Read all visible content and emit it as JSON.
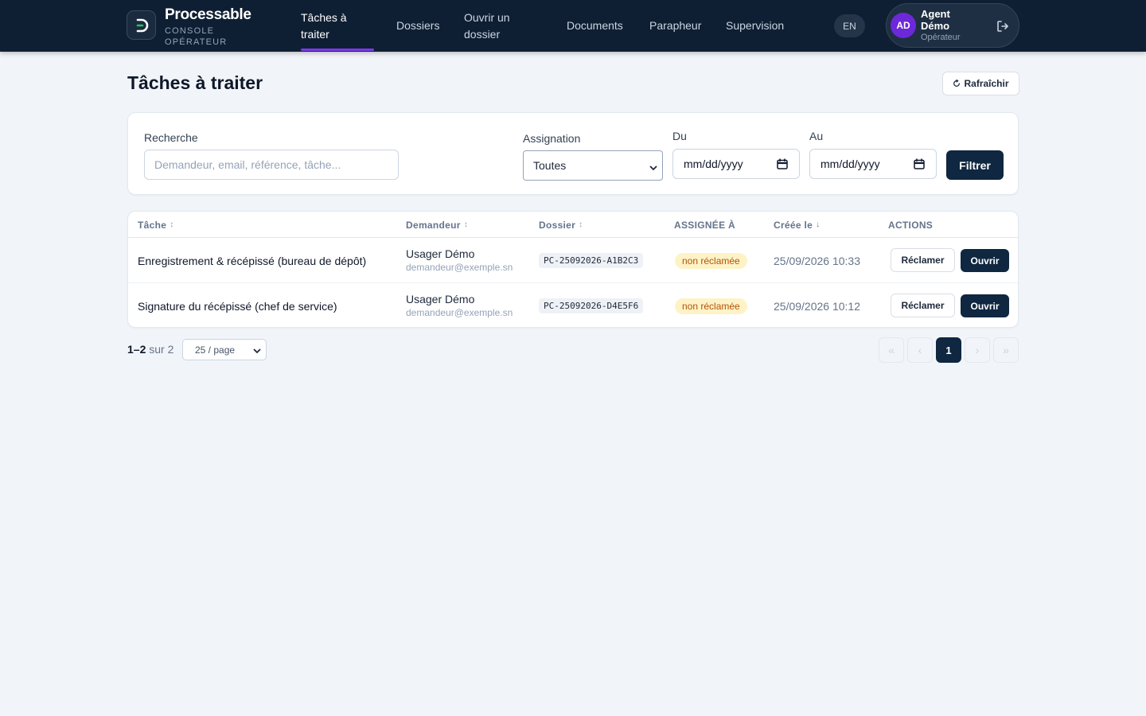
{
  "app": {
    "name": "Processable",
    "subtitle": "CONSOLE OPÉRATEUR"
  },
  "nav": {
    "items": [
      {
        "label": "Tâches à traiter",
        "active": true
      },
      {
        "label": "Dossiers"
      },
      {
        "label": "Ouvrir un dossier"
      },
      {
        "label": "Documents"
      },
      {
        "label": "Parapheur"
      },
      {
        "label": "Supervision"
      }
    ],
    "lang": "EN"
  },
  "user": {
    "initials": "AD",
    "name": "Agent Démo",
    "role": "Opérateur"
  },
  "page": {
    "title": "Tâches à traiter",
    "refresh_label": "Rafraîchir"
  },
  "filters": {
    "search_label": "Recherche",
    "search_placeholder": "Demandeur, email, référence, tâche...",
    "assignation_label": "Assignation",
    "assignation_value": "Toutes",
    "from_label": "Du",
    "from_placeholder": "mm/dd/yyyy",
    "to_label": "Au",
    "to_placeholder": "mm/dd/yyyy",
    "submit_label": "Filtrer"
  },
  "table": {
    "columns": [
      "Tâche",
      "Demandeur",
      "Dossier",
      "ASSIGNÉE À",
      "Créée le",
      "ACTIONS"
    ],
    "claim_label": "Réclamer",
    "open_label": "Ouvrir",
    "rows": [
      {
        "task": "Enregistrement & récépissé (bureau de dépôt)",
        "requester_name": "Usager Démo",
        "requester_email": "demandeur@exemple.sn",
        "dossier": "PC-25092026-A1B2C3",
        "assigned": "non réclamée",
        "created": "25/09/2026 10:33"
      },
      {
        "task": "Signature du récépissé (chef de service)",
        "requester_name": "Usager Démo",
        "requester_email": "demandeur@exemple.sn",
        "dossier": "PC-25092026-D4E5F6",
        "assigned": "non réclamée",
        "created": "25/09/2026 10:12"
      }
    ]
  },
  "pagination": {
    "range": "1–2",
    "total_text": "sur 2",
    "per_page": "25 / page",
    "first": "«",
    "prev": "‹",
    "current": "1",
    "next": "›",
    "last": "»"
  },
  "colors": {
    "header_bg": "#0f1f33",
    "accent": "#7c3aed",
    "primary_button": "#0f2740",
    "badge_text": "#b45309",
    "badge_bg": "#fef3c7"
  }
}
